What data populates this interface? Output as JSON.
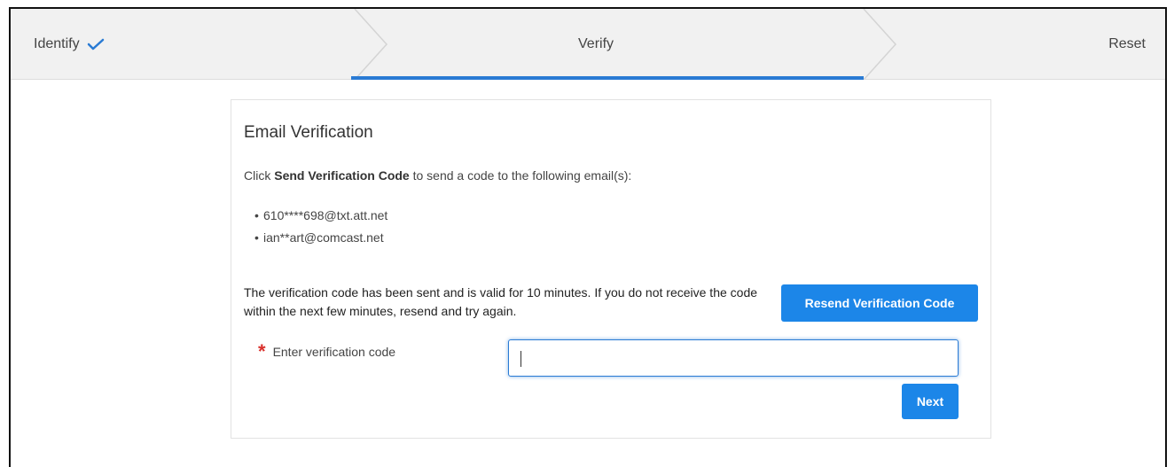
{
  "stepper": {
    "steps": [
      {
        "label": "Identify",
        "state": "done"
      },
      {
        "label": "Verify",
        "state": "active"
      },
      {
        "label": "Reset",
        "state": "pending"
      }
    ]
  },
  "card": {
    "title": "Email Verification",
    "instruction_prefix": "Click ",
    "instruction_bold": "Send Verification Code",
    "instruction_suffix": " to send a code to the following email(s):",
    "emails": [
      "610****698@txt.att.net",
      "ian**art@comcast.net"
    ],
    "status_text": "The verification code has been sent and is valid for 10 minutes. If you do not receive the code within the next few minutes, resend and try again.",
    "resend_label": "Resend Verification Code",
    "code_field": {
      "label": "Enter verification code",
      "value": "",
      "required_mark": "*"
    },
    "next_label": "Next"
  },
  "colors": {
    "accent": "#1c86e8",
    "active_step_bar": "#2a7bd4",
    "required": "#d9302c",
    "stepper_bg": "#f1f1f1"
  },
  "icons": {
    "done_step": "check-icon",
    "required": "asterisk-icon"
  }
}
